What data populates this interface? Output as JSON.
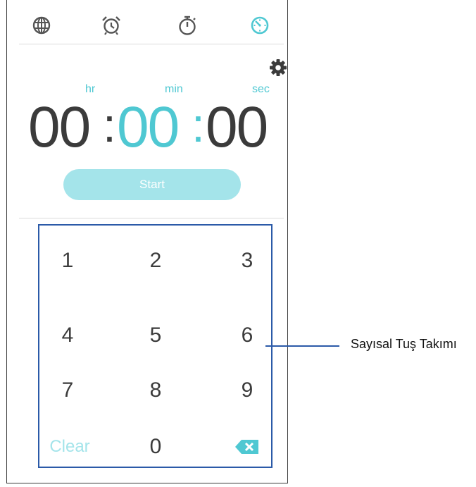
{
  "tabs": [
    {
      "icon": "globe-icon"
    },
    {
      "icon": "alarm-clock-icon"
    },
    {
      "icon": "stopwatch-icon"
    },
    {
      "icon": "timer-icon",
      "active": true
    }
  ],
  "settings_icon": "gear-icon",
  "timer": {
    "units": {
      "hr": "hr",
      "min": "min",
      "sec": "sec"
    },
    "hours": "00",
    "minutes": "00",
    "seconds": "00",
    "colon": ":"
  },
  "start_label": "Start",
  "keypad": {
    "keys": [
      "1",
      "2",
      "3",
      "4",
      "5",
      "6",
      "7",
      "8",
      "9"
    ],
    "clear_label": "Clear",
    "zero_label": "0",
    "backspace_icon": "backspace-icon"
  },
  "callout_label": "Sayısal Tuş Takımı",
  "colors": {
    "accent": "#4fc8d2",
    "start_button": "#a4e4ea",
    "digits": "#3b3b3b",
    "keypad_border": "#2b5aa8"
  }
}
